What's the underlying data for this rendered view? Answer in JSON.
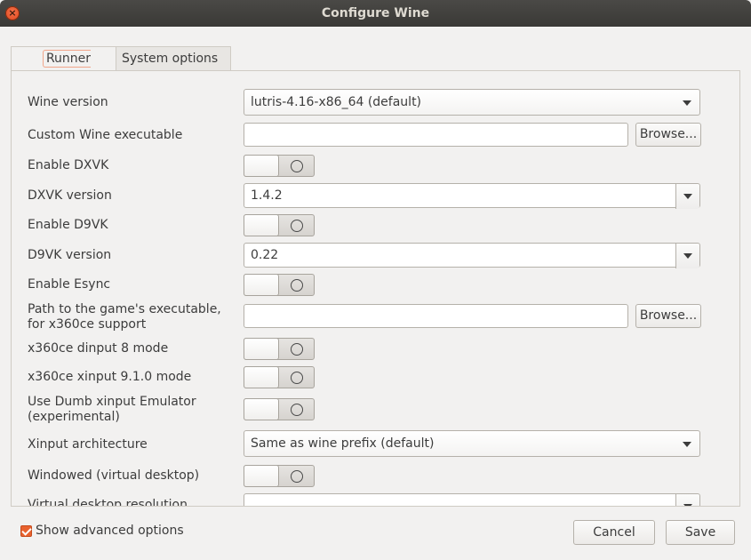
{
  "window": {
    "title": "Configure Wine"
  },
  "tabs": [
    {
      "label": "Runner options",
      "active": true
    },
    {
      "label": "System options",
      "active": false
    }
  ],
  "options": {
    "wine_version": {
      "label": "Wine version",
      "value": "lutris-4.16-x86_64  (default)"
    },
    "custom_wine_executable": {
      "label": "Custom Wine executable",
      "value": "",
      "browse_label": "Browse..."
    },
    "enable_dxvk": {
      "label": "Enable DXVK",
      "on": false
    },
    "dxvk_version": {
      "label": "DXVK version",
      "value": "1.4.2"
    },
    "enable_d9vk": {
      "label": "Enable D9VK",
      "on": false
    },
    "d9vk_version": {
      "label": "D9VK version",
      "value": "0.22"
    },
    "enable_esync": {
      "label": "Enable Esync",
      "on": false
    },
    "game_exe_path": {
      "label_line1": "Path to the game's executable,",
      "label_line2": "for x360ce support",
      "value": "",
      "browse_label": "Browse..."
    },
    "x360ce_dinput8": {
      "label": "x360ce dinput 8 mode",
      "on": false
    },
    "x360ce_xinput910": {
      "label": "x360ce xinput 9.1.0 mode",
      "on": false
    },
    "dumb_xinput": {
      "label_line1": "Use Dumb xinput Emulator",
      "label_line2": "(experimental)",
      "on": false
    },
    "xinput_arch": {
      "label": "Xinput architecture",
      "value": "Same as wine prefix  (default)"
    },
    "windowed": {
      "label": "Windowed (virtual desktop)",
      "on": false
    },
    "virtual_desktop_resolution": {
      "label": "Virtual desktop resolution"
    }
  },
  "footer": {
    "show_advanced_label": "Show advanced options",
    "show_advanced_checked": true,
    "cancel_label": "Cancel",
    "save_label": "Save"
  },
  "colors": {
    "accent": "#e9622e",
    "titlebar": "#3f3e3b",
    "background": "#f2f1f0"
  },
  "icons": {
    "close": "close-icon",
    "dropdown": "chevron-down-icon",
    "toggle_off": "toggle-off-icon",
    "check": "checkmark-icon"
  }
}
